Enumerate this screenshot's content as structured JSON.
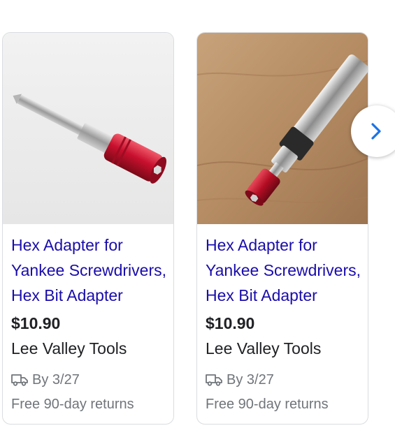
{
  "products": [
    {
      "title": "Hex Adapter for Yankee Screwdrivers, Hex Bit Adapter",
      "price": "$10.90",
      "seller": "Lee Valley Tools",
      "delivery": "By 3/27",
      "returns": "Free 90-day returns"
    },
    {
      "title": "Hex Adapter for Yankee Screwdrivers, Hex Bit Adapter",
      "price": "$10.90",
      "seller": "Lee Valley Tools",
      "delivery": "By 3/27",
      "returns": "Free 90-day returns"
    }
  ],
  "icons": {
    "delivery": "delivery-truck-icon",
    "next": "chevron-right-icon"
  },
  "colors": {
    "title_link": "#1a0dab",
    "accent": "#1a73e8",
    "adapter_red": "#c8102e"
  }
}
